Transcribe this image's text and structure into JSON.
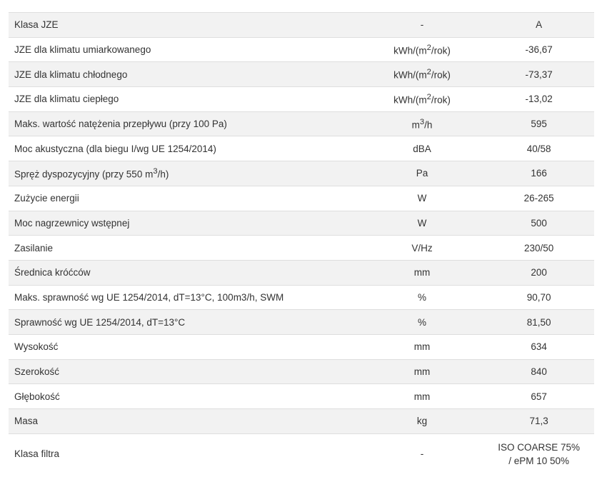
{
  "rows": [
    {
      "name": "Klasa JZE",
      "unit": "-",
      "value": "A"
    },
    {
      "name": "JZE dla klimatu umiarkowanego",
      "unit_main": "kWh/(m",
      "unit_sup": "2",
      "unit_tail": "/rok)",
      "value": "-36,67"
    },
    {
      "name": "JZE dla klimatu chłodnego",
      "unit_main": "kWh/(m",
      "unit_sup": "2",
      "unit_tail": "/rok)",
      "value": "-73,37"
    },
    {
      "name": "JZE dla klimatu ciepłego",
      "unit_main": "kWh/(m",
      "unit_sup": "2",
      "unit_tail": "/rok)",
      "value": "-13,02"
    },
    {
      "name": "Maks. wartość natężenia przepływu (przy 100 Pa)",
      "unit_main": "m",
      "unit_sup": "3",
      "unit_tail": "/h",
      "value": "595"
    },
    {
      "name": "Moc akustyczna (dla biegu I/wg UE 1254/2014)",
      "unit": "dBA",
      "value": "40/58"
    },
    {
      "name_main": "Spręż dyspozycyjny (przy 550 m",
      "name_sup": "3",
      "name_tail": "/h)",
      "unit": "Pa",
      "value": "166"
    },
    {
      "name": "Zużycie energii",
      "unit": "W",
      "value": "26-265"
    },
    {
      "name": "Moc nagrzewnicy wstępnej",
      "unit": "W",
      "value": "500"
    },
    {
      "name": "Zasilanie",
      "unit": "V/Hz",
      "value": "230/50"
    },
    {
      "name": "Średnica króćców",
      "unit": "mm",
      "value": "200"
    },
    {
      "name": "Maks. sprawność wg UE 1254/2014, dT=13°C, 100m3/h, SWM",
      "unit": "%",
      "value": "90,70"
    },
    {
      "name": "Sprawność wg UE 1254/2014, dT=13°C",
      "unit": "%",
      "value": "81,50"
    },
    {
      "name": "Wysokość",
      "unit": "mm",
      "value": "634"
    },
    {
      "name": "Szerokość",
      "unit": "mm",
      "value": "840"
    },
    {
      "name": "Głębokość",
      "unit": "mm",
      "value": "657"
    },
    {
      "name": "Masa",
      "unit": "kg",
      "value": "71,3"
    },
    {
      "name": "Klasa filtra",
      "unit": "-",
      "value_line1": "ISO COARSE 75%",
      "value_line2": "/ ePM 10 50%"
    }
  ]
}
